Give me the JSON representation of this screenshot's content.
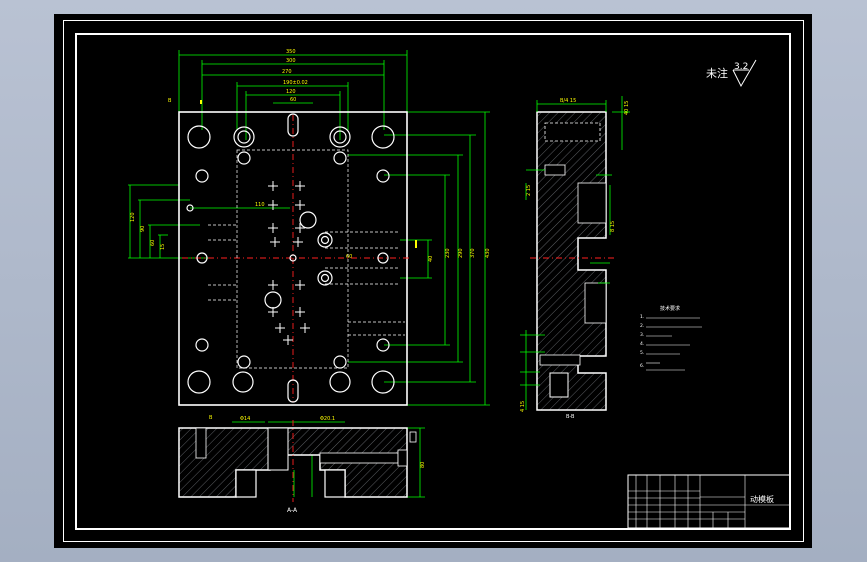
{
  "drawing": {
    "title_block_name": "动模板",
    "roughness_note": "未注",
    "roughness_value": "3.2",
    "section_label_bottom": "A-A",
    "section_label_side": "B-B",
    "tech_requirements_title": "技术要求",
    "tech_notes": [
      "1.",
      "2.",
      "3.",
      "4.",
      "5.",
      "6."
    ],
    "colors": {
      "background": "#000000",
      "outline": "#ffffff",
      "dimension": "#00ff00",
      "dimension_text": "#ffff00",
      "centerline": "#ff0000",
      "hidden_line": "#ffffff"
    }
  }
}
